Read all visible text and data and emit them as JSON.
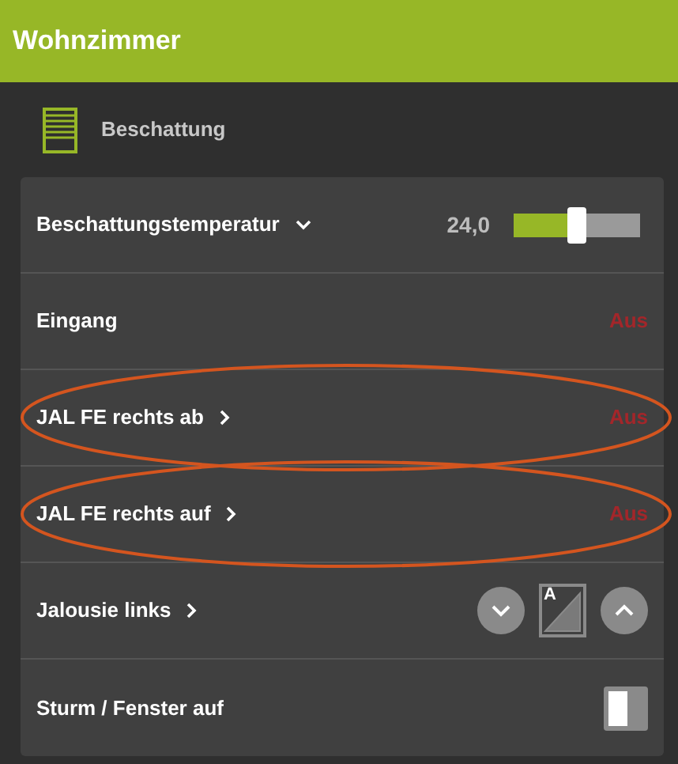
{
  "header": {
    "title": "Wohnzimmer"
  },
  "section": {
    "title": "Beschattung"
  },
  "rows": [
    {
      "kind": "slider",
      "label": "Beschattungstemperatur",
      "expanded": true,
      "reading": "24,0",
      "level": 0.5,
      "circled": false
    },
    {
      "kind": "status",
      "label": "Eingang",
      "value": "Aus",
      "circled": false
    },
    {
      "kind": "status",
      "label": "JAL FE rechts ab",
      "expanded": false,
      "value": "Aus",
      "circled": true
    },
    {
      "kind": "status",
      "label": "JAL FE rechts auf",
      "expanded": false,
      "value": "Aus",
      "circled": true
    },
    {
      "kind": "blind",
      "label": "Jalousie links",
      "expanded": false,
      "auto_label": "A",
      "circled": false
    },
    {
      "kind": "toggle",
      "label": "Sturm / Fenster auf",
      "on": false,
      "circled": false
    }
  ]
}
